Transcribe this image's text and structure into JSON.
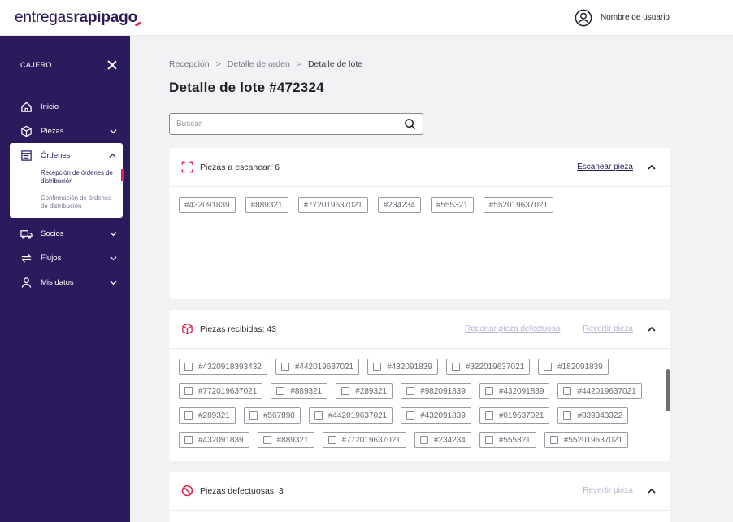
{
  "header": {
    "logo_regular": "entregas",
    "logo_bold": "rapipago",
    "user_name": "Nombre de usuario"
  },
  "sidebar": {
    "role": "CAJERO",
    "items": [
      {
        "label": "Inicio"
      },
      {
        "label": "Piezas"
      },
      {
        "label": "Órdenes",
        "sub": [
          "Recepción de órdenes de distribución",
          "Confirmación de órdenes de distribución"
        ]
      },
      {
        "label": "Socios"
      },
      {
        "label": "Flujos"
      },
      {
        "label": "Mis datos"
      }
    ]
  },
  "breadcrumb": [
    "Recepción",
    ">",
    "Detalle de orden",
    ">",
    "Detalle de lote"
  ],
  "page_title": "Detalle de lote #472324",
  "search": {
    "placeholder": "Buscar"
  },
  "colors": {
    "brand": "#2b1a5c",
    "accent": "#e0214b"
  },
  "panels": {
    "to_scan": {
      "title": "Piezas a escanear: 6",
      "action": "Escanear pieza",
      "items": [
        "#432091839",
        "#889321",
        "#772019637021",
        "#234234",
        "#555321",
        "#552019637021"
      ]
    },
    "received": {
      "title": "Piezas recibidas: 43",
      "action_report": "Reportar pieza defectuosa",
      "action_revert": "Revertir pieza",
      "items": [
        "#4320918393432",
        "#442019637021",
        "#432091839",
        "#322019637021",
        "#182091839",
        "#772019637021",
        "#889321",
        "#289321",
        "#982091839",
        "#432091839",
        "#442019637021",
        "#289321",
        "#567890",
        "#442019637021",
        "#432091839",
        "#019637021",
        "#839343322",
        "#432091839",
        "#889321",
        "#772019637021",
        "#234234",
        "#555321",
        "#552019637021"
      ]
    },
    "defective": {
      "title": "Piezas defectuosas: 3",
      "action_revert": "Revertir pieza"
    }
  }
}
